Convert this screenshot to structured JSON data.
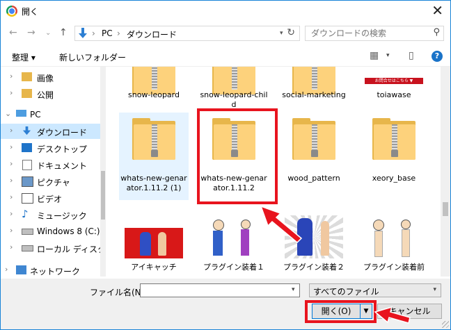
{
  "window": {
    "title": "開く"
  },
  "address": {
    "crumbs": [
      "PC",
      "ダウンロード"
    ],
    "search_placeholder": "ダウンロードの検索"
  },
  "toolbar": {
    "organize": "整理 ▾",
    "new_folder": "新しいフォルダー"
  },
  "sidebar": {
    "items": [
      {
        "label": "画像"
      },
      {
        "label": "公開"
      },
      {
        "label": "PC"
      },
      {
        "label": "ダウンロード"
      },
      {
        "label": "デスクトップ"
      },
      {
        "label": "ドキュメント"
      },
      {
        "label": "ピクチャ"
      },
      {
        "label": "ビデオ"
      },
      {
        "label": "ミュージック"
      },
      {
        "label": "Windows 8 (C:)"
      },
      {
        "label": "ローカル ディスク (D"
      },
      {
        "label": "ネットワーク"
      }
    ]
  },
  "files": {
    "row1": [
      {
        "caption": "snow-leopard"
      },
      {
        "caption": "snow-leopard-child"
      },
      {
        "caption": "social-marketing"
      },
      {
        "caption": "toiawase",
        "thumb_text": "お問合せはこちら ▼"
      }
    ],
    "row2": [
      {
        "caption": "whats-new-genarator.1.11.2 (1)"
      },
      {
        "caption": "whats-new-genarator.1.11.2"
      },
      {
        "caption": "wood_pattern"
      },
      {
        "caption": "xeory_base"
      }
    ],
    "row3": [
      {
        "caption": "アイキャッチ"
      },
      {
        "caption": "プラグイン装着１"
      },
      {
        "caption": "プラグイン装着２"
      },
      {
        "caption": "プラグイン装着前"
      }
    ]
  },
  "footer": {
    "filename_label": "ファイル名(N):",
    "filename_value": "",
    "filetype_value": "すべてのファイル",
    "open_label": "開く(O)",
    "cancel_label": "キャンセル"
  },
  "colors": {
    "accent": "#1883d7",
    "highlight": "#e8141e",
    "selected": "#cce8ff"
  }
}
